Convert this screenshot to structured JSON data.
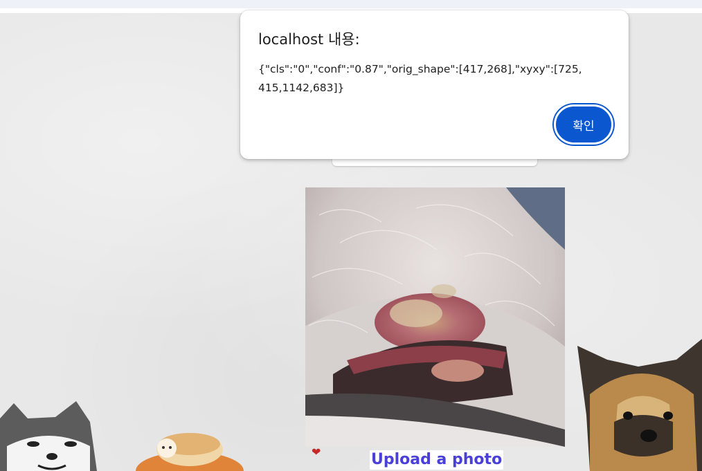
{
  "dialog": {
    "title": "localhost 내용:",
    "message": "{\"cls\":\"0\",\"conf\":\"0.87\",\"orig_shape\":[417,268],\"xyxy\":[725,415,1142,683]}",
    "ok_label": "확인"
  },
  "upload": {
    "label": "Upload a photo"
  },
  "colors": {
    "accent": "#0b57d0",
    "upload_text": "#4a3fd6",
    "background": "#e8e8e8"
  },
  "icons": [
    "heart-icon"
  ]
}
